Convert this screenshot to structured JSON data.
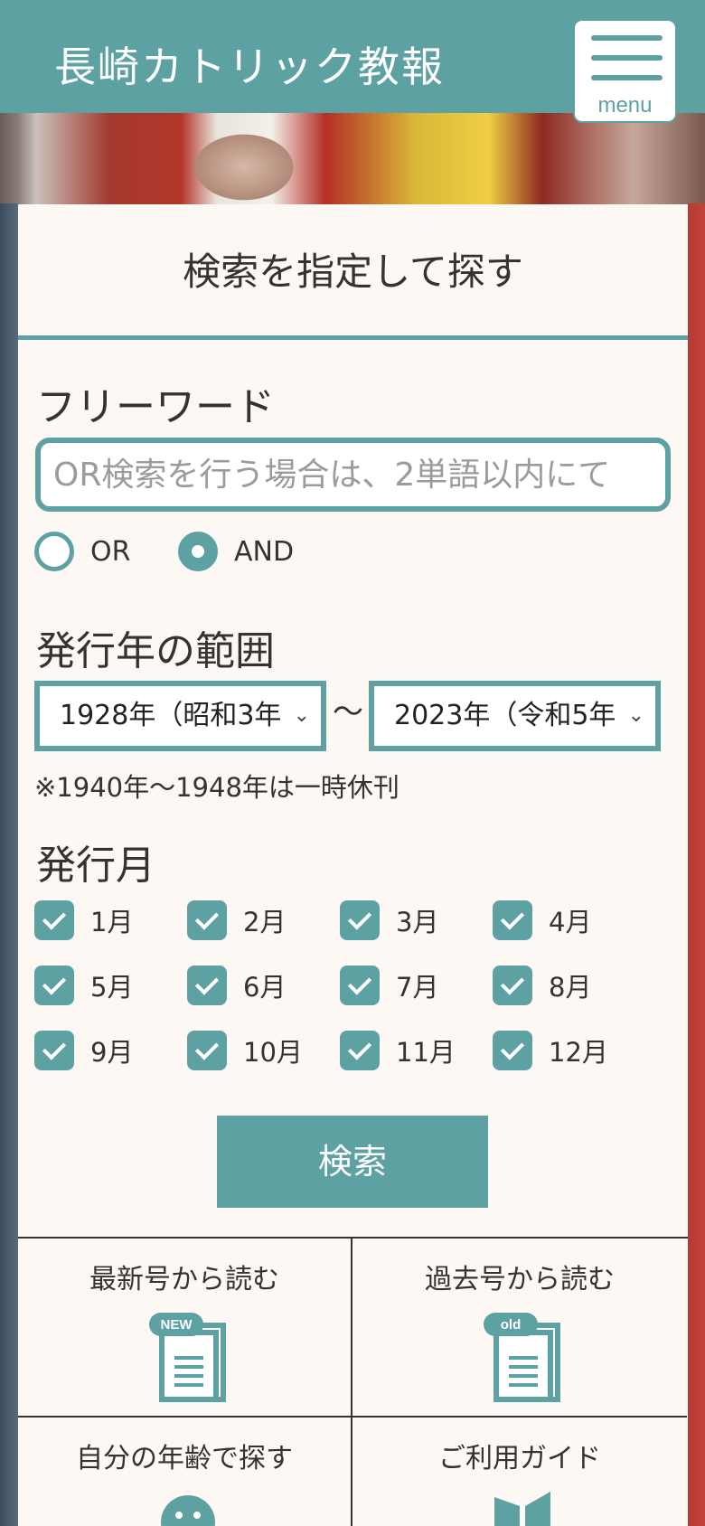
{
  "header": {
    "title": "長崎カトリック教報",
    "menu_label": "menu"
  },
  "search": {
    "heading": "検索を指定して探す",
    "free_word_label": "フリーワード",
    "free_word_placeholder": "OR検索を行う場合は、2単語以内にて",
    "free_word_value": "",
    "mode_options": [
      {
        "label": "OR",
        "selected": false
      },
      {
        "label": "AND",
        "selected": true
      }
    ],
    "year_range_label": "発行年の範囲",
    "year_from": "1928年（昭和3年",
    "year_to": "2023年（令和5年",
    "range_separator": "〜",
    "note": "※1940年〜1948年は一時休刊",
    "month_label": "発行月",
    "months": [
      {
        "label": "1月",
        "checked": true
      },
      {
        "label": "2月",
        "checked": true
      },
      {
        "label": "3月",
        "checked": true
      },
      {
        "label": "4月",
        "checked": true
      },
      {
        "label": "5月",
        "checked": true
      },
      {
        "label": "6月",
        "checked": true
      },
      {
        "label": "7月",
        "checked": true
      },
      {
        "label": "8月",
        "checked": true
      },
      {
        "label": "9月",
        "checked": true
      },
      {
        "label": "10月",
        "checked": true
      },
      {
        "label": "11月",
        "checked": true
      },
      {
        "label": "12月",
        "checked": true
      }
    ],
    "submit_label": "検索"
  },
  "quick_links": [
    {
      "label": "最新号から読む",
      "badge": "NEW",
      "icon": "document-icon"
    },
    {
      "label": "過去号から読む",
      "badge": "old",
      "icon": "document-icon"
    },
    {
      "label": "自分の年齢で探す",
      "icon": "face-icon"
    },
    {
      "label": "ご利用ガイド",
      "icon": "book-icon"
    }
  ],
  "colors": {
    "accent": "#5da1a3",
    "panel_bg": "#fdf8f4"
  }
}
